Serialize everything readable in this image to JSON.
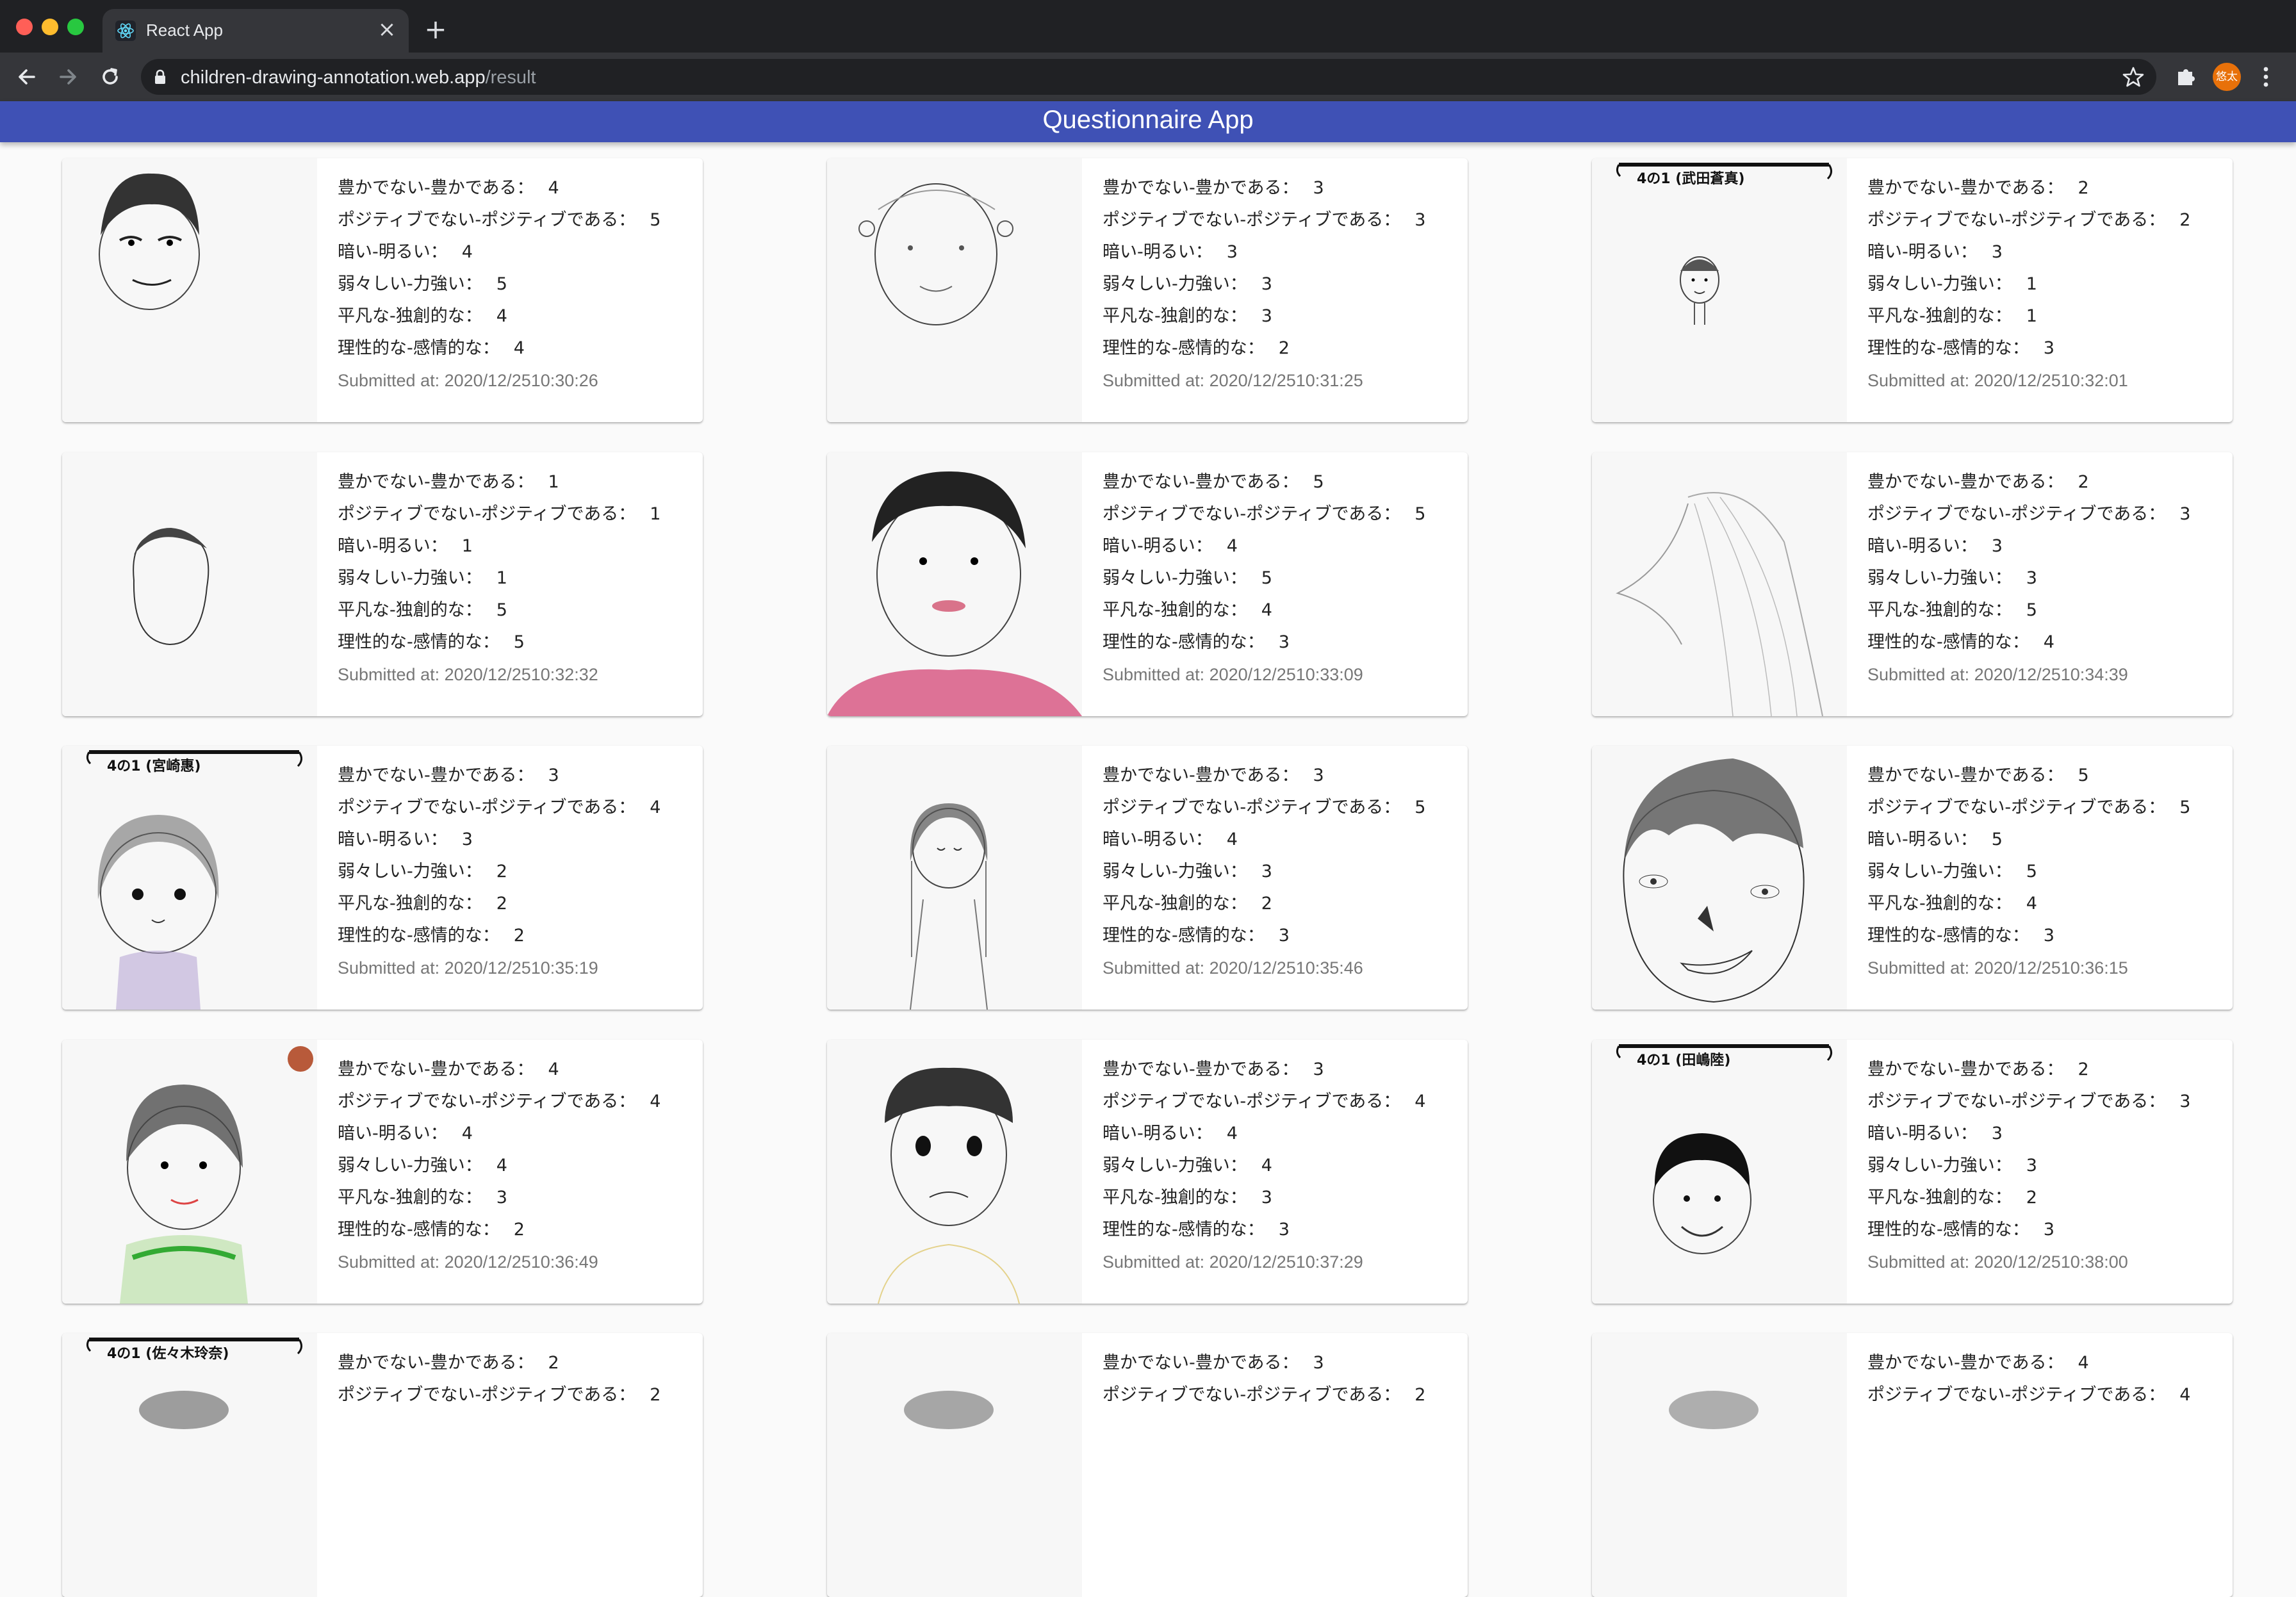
{
  "browser": {
    "tab_title": "React App",
    "url_host": "children-drawing-annotation.web.app",
    "url_path": "/result",
    "profile_initials": "悠太"
  },
  "app": {
    "title": "Questionnaire App"
  },
  "labels": {
    "rich": "豊かでない-豊かである：",
    "positive": "ポジティブでない-ポジティブである：",
    "bright": "暗い-明るい：",
    "strong": "弱々しい-力強い：",
    "original": "平凡な-独創的な：",
    "emotional": "理性的な-感情的な：",
    "submitted_prefix": "Submitted at: "
  },
  "colors": {
    "appbar": "#3f51b5",
    "avatar": "#e8710a"
  },
  "cards": [
    {
      "rich": "4",
      "positive": "5",
      "bright": "4",
      "strong": "5",
      "original": "4",
      "emotional": "4",
      "submitted": "2020/12/2510:30:26"
    },
    {
      "rich": "3",
      "positive": "3",
      "bright": "3",
      "strong": "3",
      "original": "3",
      "emotional": "2",
      "submitted": "2020/12/2510:31:25"
    },
    {
      "rich": "2",
      "positive": "2",
      "bright": "3",
      "strong": "1",
      "original": "1",
      "emotional": "3",
      "submitted": "2020/12/2510:32:01"
    },
    {
      "rich": "1",
      "positive": "1",
      "bright": "1",
      "strong": "1",
      "original": "5",
      "emotional": "5",
      "submitted": "2020/12/2510:32:32"
    },
    {
      "rich": "5",
      "positive": "5",
      "bright": "4",
      "strong": "5",
      "original": "4",
      "emotional": "3",
      "submitted": "2020/12/2510:33:09"
    },
    {
      "rich": "2",
      "positive": "3",
      "bright": "3",
      "strong": "3",
      "original": "5",
      "emotional": "4",
      "submitted": "2020/12/2510:34:39"
    },
    {
      "rich": "3",
      "positive": "4",
      "bright": "3",
      "strong": "2",
      "original": "2",
      "emotional": "2",
      "submitted": "2020/12/2510:35:19"
    },
    {
      "rich": "3",
      "positive": "5",
      "bright": "4",
      "strong": "3",
      "original": "2",
      "emotional": "3",
      "submitted": "2020/12/2510:35:46"
    },
    {
      "rich": "5",
      "positive": "5",
      "bright": "5",
      "strong": "5",
      "original": "4",
      "emotional": "3",
      "submitted": "2020/12/2510:36:15"
    },
    {
      "rich": "4",
      "positive": "4",
      "bright": "4",
      "strong": "4",
      "original": "3",
      "emotional": "2",
      "submitted": "2020/12/2510:36:49"
    },
    {
      "rich": "3",
      "positive": "4",
      "bright": "4",
      "strong": "4",
      "original": "3",
      "emotional": "3",
      "submitted": "2020/12/2510:37:29"
    },
    {
      "rich": "2",
      "positive": "3",
      "bright": "3",
      "strong": "3",
      "original": "2",
      "emotional": "3",
      "submitted": "2020/12/2510:38:00"
    },
    {
      "rich": "2",
      "positive": "2"
    },
    {
      "rich": "3",
      "positive": "2"
    },
    {
      "rich": "4",
      "positive": "4"
    }
  ],
  "drawings": [
    {
      "icon": "boy-face-drawing-icon",
      "hair": "#333",
      "shade": "dark"
    },
    {
      "icon": "sketch-face-drawing-icon",
      "hair": "#777",
      "shade": "light"
    },
    {
      "icon": "small-boy-drawing-icon",
      "hair": "#555",
      "shade": "tiny",
      "header_label": "4の1 (武田蒼真)"
    },
    {
      "icon": "outline-head-drawing-icon",
      "hair": "#444",
      "shade": "outline"
    },
    {
      "icon": "red-shirt-boy-drawing-icon",
      "hair": "#222",
      "shade": "pink"
    },
    {
      "icon": "long-hair-profile-drawing-icon",
      "hair": "#888",
      "shade": "profile"
    },
    {
      "icon": "girl-drawing-icon",
      "hair": "#666",
      "shade": "girl",
      "header_label": "4の1 (宮崎惠)"
    },
    {
      "icon": "long-hair-girl-drawing-icon",
      "hair": "#555",
      "shade": "girl2"
    },
    {
      "icon": "big-face-drawing-icon",
      "hair": "#555",
      "shade": "big"
    },
    {
      "icon": "green-shirt-boy-drawing-icon",
      "hair": "#444",
      "shade": "green"
    },
    {
      "icon": "bowl-cut-boy-drawing-icon",
      "hair": "#333",
      "shade": "bowl"
    },
    {
      "icon": "smiling-boy-drawing-icon",
      "hair": "#111",
      "shade": "smile",
      "header_label": "4の1 (田嶋陸)"
    },
    {
      "icon": "partial-drawing-icon",
      "hair": "#444",
      "shade": "partial",
      "header_label": "4の1 (佐々木玲奈)"
    },
    {
      "icon": "partial-drawing-icon",
      "hair": "#555",
      "shade": "partial2"
    },
    {
      "icon": "partial-drawing-icon",
      "hair": "#666",
      "shade": "partial3"
    }
  ]
}
